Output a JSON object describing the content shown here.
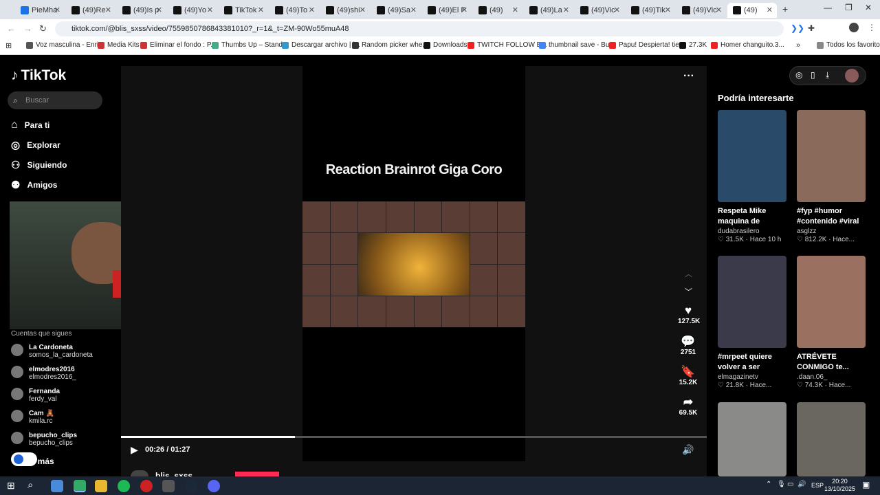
{
  "browser": {
    "tabs": [
      "PieMha",
      "(49)Re",
      "(49)Is p",
      "(49)Yo",
      "TikTok",
      "(49)To",
      "(49)shi",
      "(49)Sa",
      "(49)El P",
      "(49)",
      "(49)La",
      "(49)Vic",
      "(49)Tik",
      "(49)Vic",
      "(49)"
    ],
    "url": "tiktok.com/@blis_sxss/video/7559850786843381010?_r=1&_t=ZM-90Wo55muA48",
    "bookmarks": [
      "Voz masculina - Enri...",
      "Media Kits",
      "Eliminar el fondo : P...",
      "Thumbs Up – Stand...",
      "Descargar archivo | i...",
      "Random picker whe...",
      "Downloads",
      "TWITCH FOLLOW B...",
      "thumbnail save - Bu...",
      "Papu! Despierta! tie...",
      "27.3K",
      "Homer changuito.3...",
      "Todos los favoritos"
    ]
  },
  "sidebar": {
    "logo": "TikTok",
    "search_placeholder": "Buscar",
    "nav": [
      "Para ti",
      "Explorar",
      "Siguiendo",
      "Amigos"
    ],
    "following_title": "Cuentas que sigues",
    "accounts": [
      {
        "name": "La Cardoneta",
        "handle": "somos_la_cardoneta"
      },
      {
        "name": "elmodres2016",
        "handle": "elmodres2016_"
      },
      {
        "name": "Fernanda",
        "handle": "ferdy_val"
      },
      {
        "name": "Cam 🧸",
        "handle": "kmila.rc"
      },
      {
        "name": "bepucho_clips",
        "handle": "bepucho_clips"
      }
    ],
    "more_label": "er más"
  },
  "player": {
    "caption": "Reaction Brainrot Giga Coro",
    "time": "00:26 / 01:27",
    "progress": 0.297,
    "author": "blis_sxss",
    "likes": "127.5K",
    "comments": "2751",
    "saves": "15.2K",
    "shares": "69.5K"
  },
  "recommendations": {
    "title": "Podría interesarte",
    "items": [
      {
        "title": "Respeta Mike maquina de humo....",
        "user": "dudabrasilero",
        "stats": "31.5K · Hace 10 h",
        "color": "#2a4a6a"
      },
      {
        "title": "#fyp #humor #contenido #viral l...",
        "user": "asglzz",
        "stats": "812.2K · Hace...",
        "color": "#8a6a5a"
      },
      {
        "title": "#mrpeet quiere volver a ser directo...",
        "user": "elmagazinetv",
        "stats": "21.8K · Hace...",
        "color": "#3a3a4a"
      },
      {
        "title": "ATRÉVETE CONMIGO te...",
        "user": ".daan.06_",
        "stats": "74.3K · Hace...",
        "color": "#9a7060"
      },
      {
        "title": "",
        "user": "",
        "stats": "",
        "color": "#8a8a88"
      },
      {
        "title": "",
        "user": "",
        "stats": "",
        "color": "#6a6660"
      }
    ]
  },
  "taskbar": {
    "lang": "ESP",
    "time": "20:20",
    "date": "13/10/2025"
  }
}
